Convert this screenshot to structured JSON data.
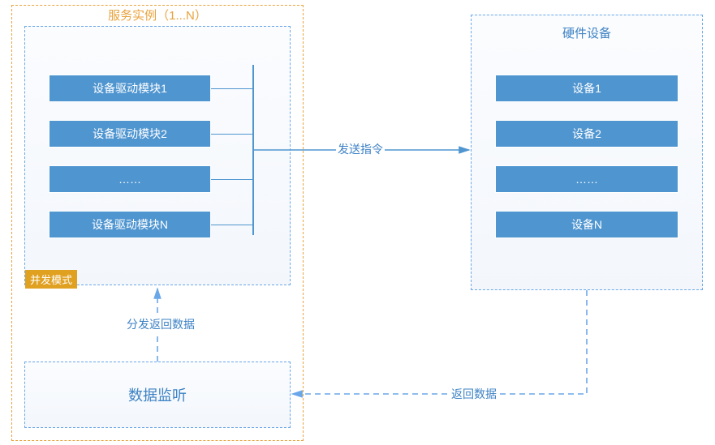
{
  "diagram": {
    "service_instance": {
      "title": "服务实例（1...N）",
      "badge": "并发模式",
      "driver_modules": [
        "设备驱动模块1",
        "设备驱动模块2",
        "……",
        "设备驱动模块N"
      ]
    },
    "hardware": {
      "title": "硬件设备",
      "devices": [
        "设备1",
        "设备2",
        "……",
        "设备N"
      ]
    },
    "data_listener": {
      "title": "数据监听"
    },
    "arrows": {
      "send_cmd": "发送指令",
      "return_data": "返回数据",
      "dispatch_back": "分发返回数据"
    },
    "colors": {
      "blue": "#4f95d0",
      "blue_line": "#6aa7e8",
      "orange": "#e8a33d",
      "badge": "#e0a020"
    }
  }
}
